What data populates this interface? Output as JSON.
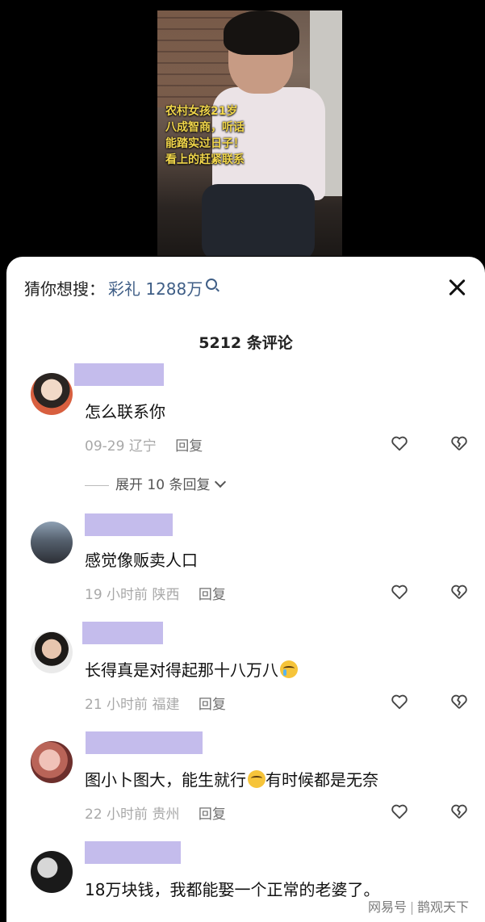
{
  "video": {
    "overlay_lines": [
      "农村女孩21岁",
      "八成智商，听话",
      "能踏实过日子！",
      "看上的赶紧联系"
    ]
  },
  "search": {
    "label": "猜你想搜：",
    "query": "彩礼 1288万"
  },
  "comments_header": {
    "count_text": "5212 条评论"
  },
  "comments": [
    {
      "text": "怎么联系你",
      "date": "09-29",
      "location": "辽宁",
      "reply": "回复",
      "expand": "展开 10 条回复"
    },
    {
      "text": "感觉像贩卖人口",
      "date": "19 小时前",
      "location": "陕西",
      "reply": "回复"
    },
    {
      "text": "长得真是对得起那十八万八",
      "date": "21 小时前",
      "location": "福建",
      "reply": "回复"
    },
    {
      "text_before": "图小卜图大，能生就行",
      "text_after": "有时候都是无奈",
      "date": "22 小时前",
      "location": "贵州",
      "reply": "回复"
    },
    {
      "text": "18万块钱，我都能娶一个正常的老婆了。"
    }
  ],
  "watermark": {
    "left": "网易号",
    "right": "鹊观天下"
  },
  "icons": {
    "like": "heart-icon",
    "dislike": "broken-heart-icon",
    "close": "close-icon",
    "search": "search-icon"
  }
}
